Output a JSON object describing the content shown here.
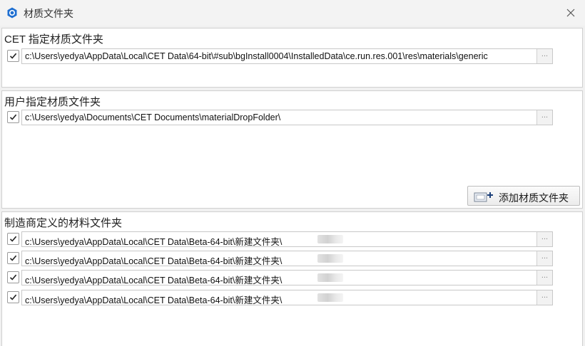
{
  "window": {
    "title": "材质文件夹",
    "icon": "cet-app-icon",
    "close": "close-icon"
  },
  "cet_section": {
    "title": "CET 指定材质文件夹",
    "rows": [
      {
        "checked": true,
        "path": "c:\\Users\\yedya\\AppData\\Local\\CET Data\\64-bit\\#sub\\bgInstall0004\\InstalledData\\ce.run.res.001\\res\\materials\\generic",
        "browse": "..."
      }
    ]
  },
  "user_section": {
    "title": "用户指定材质文件夹",
    "rows": [
      {
        "checked": true,
        "path": "c:\\Users\\yedya\\Documents\\CET Documents\\materialDropFolder\\",
        "browse": "..."
      }
    ],
    "add_button_label": "添加材质文件夹",
    "add_button_icon": "add-folder-icon"
  },
  "manufacturer_section": {
    "title": "制造商定义的材料文件夹",
    "rows": [
      {
        "checked": true,
        "path": "c:\\Users\\yedya\\AppData\\Local\\CET Data\\Beta-64-bit\\新建文件夹\\",
        "browse": "..."
      },
      {
        "checked": true,
        "path": "c:\\Users\\yedya\\AppData\\Local\\CET Data\\Beta-64-bit\\新建文件夹\\",
        "browse": "..."
      },
      {
        "checked": true,
        "path": "c:\\Users\\yedya\\AppData\\Local\\CET Data\\Beta-64-bit\\新建文件夹\\",
        "browse": "..."
      },
      {
        "checked": true,
        "path": "c:\\Users\\yedya\\AppData\\Local\\CET Data\\Beta-64-bit\\新建文件夹\\",
        "browse": "..."
      }
    ]
  }
}
